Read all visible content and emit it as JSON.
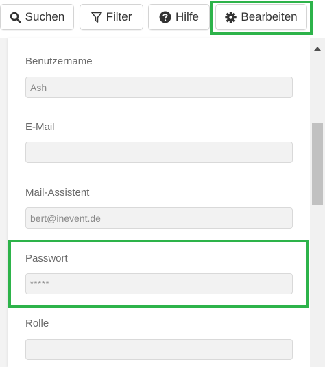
{
  "toolbar": {
    "search_label": "Suchen",
    "filter_label": "Filter",
    "help_label": "Hilfe",
    "edit_label": "Bearbeiten"
  },
  "form": {
    "username": {
      "label": "Benutzername",
      "value": "Ash"
    },
    "email": {
      "label": "E-Mail",
      "value": ""
    },
    "mail_assistant": {
      "label": "Mail-Assistent",
      "value": "bert@inevent.de"
    },
    "password": {
      "label": "Passwort",
      "value": "*****"
    },
    "role": {
      "label": "Rolle",
      "value": ""
    }
  },
  "colors": {
    "highlight": "#2db34a",
    "input_bg": "#f2f2f2",
    "label_text": "#6b6b6b"
  },
  "icons": {
    "search": "search-icon",
    "filter": "filter-icon",
    "help": "question-circle-icon",
    "edit": "gear-icon",
    "scroll_up": "triangle-up-icon"
  }
}
